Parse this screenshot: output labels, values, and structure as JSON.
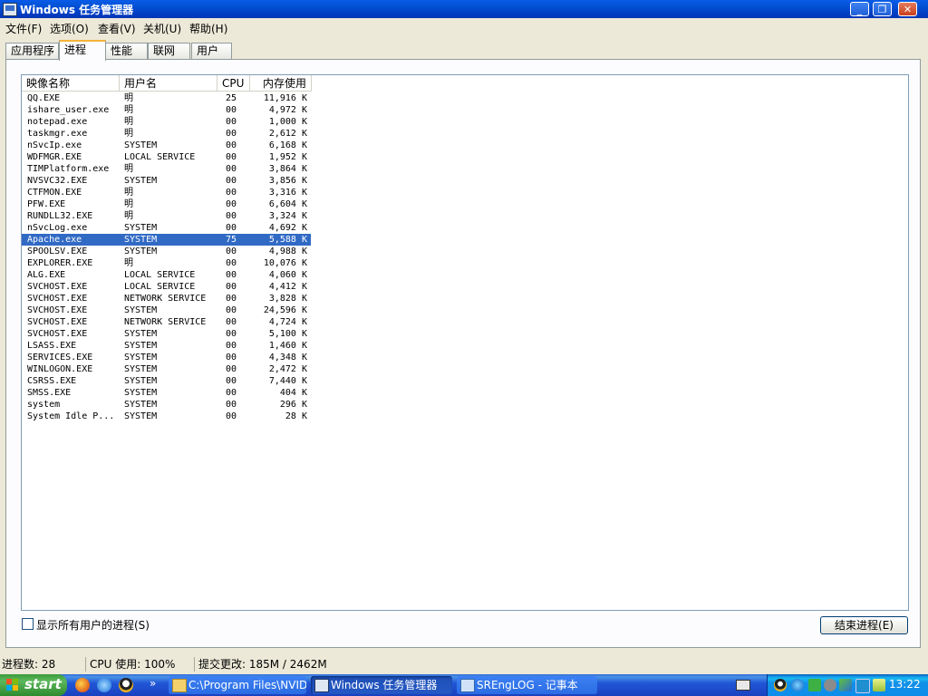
{
  "window": {
    "title": "Windows 任务管理器",
    "controls": {
      "minimize": "_",
      "maximize": "❐",
      "close": "✕"
    }
  },
  "menu": [
    "文件(F)",
    "选项(O)",
    "查看(V)",
    "关机(U)",
    "帮助(H)"
  ],
  "tabs": [
    {
      "label": "应用程序",
      "active": false
    },
    {
      "label": "进程",
      "active": true
    },
    {
      "label": "性能",
      "active": false
    },
    {
      "label": "联网",
      "active": false
    },
    {
      "label": "用户",
      "active": false
    }
  ],
  "columns": {
    "name": "映像名称",
    "user": "用户名",
    "cpu": "CPU",
    "mem": "内存使用"
  },
  "processes": [
    {
      "name": "QQ.EXE",
      "user": "明",
      "cpu": "25",
      "mem": "11,916 K"
    },
    {
      "name": "ishare_user.exe",
      "user": "明",
      "cpu": "00",
      "mem": "4,972 K"
    },
    {
      "name": "notepad.exe",
      "user": "明",
      "cpu": "00",
      "mem": "1,000 K"
    },
    {
      "name": "taskmgr.exe",
      "user": "明",
      "cpu": "00",
      "mem": "2,612 K"
    },
    {
      "name": "nSvcIp.exe",
      "user": "SYSTEM",
      "cpu": "00",
      "mem": "6,168 K"
    },
    {
      "name": "WDFMGR.EXE",
      "user": "LOCAL SERVICE",
      "cpu": "00",
      "mem": "1,952 K"
    },
    {
      "name": "TIMPlatform.exe",
      "user": "明",
      "cpu": "00",
      "mem": "3,864 K"
    },
    {
      "name": "NVSVC32.EXE",
      "user": "SYSTEM",
      "cpu": "00",
      "mem": "3,856 K"
    },
    {
      "name": "CTFMON.EXE",
      "user": "明",
      "cpu": "00",
      "mem": "3,316 K"
    },
    {
      "name": "PFW.EXE",
      "user": "明",
      "cpu": "00",
      "mem": "6,604 K"
    },
    {
      "name": "RUNDLL32.EXE",
      "user": "明",
      "cpu": "00",
      "mem": "3,324 K"
    },
    {
      "name": "nSvcLog.exe",
      "user": "SYSTEM",
      "cpu": "00",
      "mem": "4,692 K"
    },
    {
      "name": "Apache.exe",
      "user": "SYSTEM",
      "cpu": "75",
      "mem": "5,588 K",
      "selected": true
    },
    {
      "name": "SPOOLSV.EXE",
      "user": "SYSTEM",
      "cpu": "00",
      "mem": "4,988 K"
    },
    {
      "name": "EXPLORER.EXE",
      "user": "明",
      "cpu": "00",
      "mem": "10,076 K"
    },
    {
      "name": "ALG.EXE",
      "user": "LOCAL SERVICE",
      "cpu": "00",
      "mem": "4,060 K"
    },
    {
      "name": "SVCHOST.EXE",
      "user": "LOCAL SERVICE",
      "cpu": "00",
      "mem": "4,412 K"
    },
    {
      "name": "SVCHOST.EXE",
      "user": "NETWORK SERVICE",
      "cpu": "00",
      "mem": "3,828 K"
    },
    {
      "name": "SVCHOST.EXE",
      "user": "SYSTEM",
      "cpu": "00",
      "mem": "24,596 K"
    },
    {
      "name": "SVCHOST.EXE",
      "user": "NETWORK SERVICE",
      "cpu": "00",
      "mem": "4,724 K"
    },
    {
      "name": "SVCHOST.EXE",
      "user": "SYSTEM",
      "cpu": "00",
      "mem": "5,100 K"
    },
    {
      "name": "LSASS.EXE",
      "user": "SYSTEM",
      "cpu": "00",
      "mem": "1,460 K"
    },
    {
      "name": "SERVICES.EXE",
      "user": "SYSTEM",
      "cpu": "00",
      "mem": "4,348 K"
    },
    {
      "name": "WINLOGON.EXE",
      "user": "SYSTEM",
      "cpu": "00",
      "mem": "2,472 K"
    },
    {
      "name": "CSRSS.EXE",
      "user": "SYSTEM",
      "cpu": "00",
      "mem": "7,440 K"
    },
    {
      "name": "SMSS.EXE",
      "user": "SYSTEM",
      "cpu": "00",
      "mem": "404 K"
    },
    {
      "name": "system",
      "user": "SYSTEM",
      "cpu": "00",
      "mem": "296 K"
    },
    {
      "name": "System Idle P...",
      "user": "SYSTEM",
      "cpu": "00",
      "mem": "28 K"
    }
  ],
  "show_all_users": {
    "label": "显示所有用户的进程(S)",
    "checked": false
  },
  "end_process_button": "结束进程(E)",
  "status": {
    "process_count": "进程数: 28",
    "cpu_usage": "CPU 使用: 100%",
    "commit_charge": "提交更改: 185M / 2462M"
  },
  "taskbar": {
    "start_label": "start",
    "quick_launch": [
      "firefox-icon",
      "ie-icon",
      "qq-icon"
    ],
    "overflow": "»",
    "buttons": [
      {
        "label": "C:\\Program Files\\NVID...",
        "icon": "folder-icon",
        "active": false
      },
      {
        "label": "Windows 任务管理器",
        "icon": "taskmgr-icon",
        "active": true
      },
      {
        "label": "SREngLOG - 记事本",
        "icon": "notepad-icon",
        "active": false
      }
    ],
    "tray_icons": [
      "keyboard-icon",
      "qq-tray-icon",
      "network-icon",
      "nvidia-icon",
      "speaker-icon",
      "firewall-icon",
      "lan-icon",
      "battery-icon"
    ],
    "clock": "13:22"
  }
}
